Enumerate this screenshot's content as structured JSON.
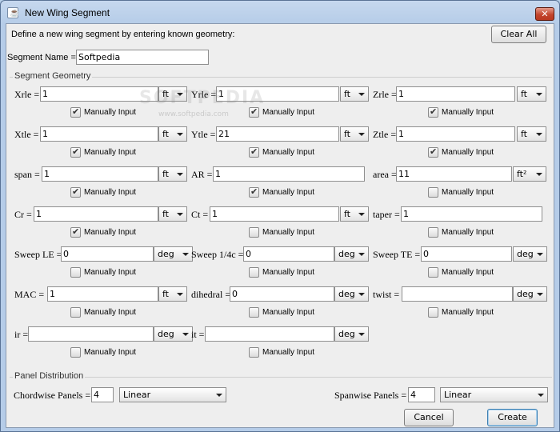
{
  "window": {
    "title": "New Wing Segment",
    "close_glyph": "✕"
  },
  "header": {
    "instruction": "Define a new wing segment by entering known geometry:",
    "clear_all_label": "Clear All"
  },
  "segment_name": {
    "label": "Segment Name =",
    "value": "Softpedia"
  },
  "geometry": {
    "title": "Segment Geometry",
    "checkbox_label": "Manually Input",
    "rows": [
      [
        {
          "label": "Xrle =",
          "value": "1",
          "unit": "ft",
          "checked": true
        },
        {
          "label": "Yrle =",
          "value": "1",
          "unit": "ft",
          "checked": true
        },
        {
          "label": "Zrle =",
          "value": "1",
          "unit": "ft",
          "checked": true
        }
      ],
      [
        {
          "label": "Xtle =",
          "value": "1",
          "unit": "ft",
          "checked": true
        },
        {
          "label": "Ytle =",
          "value": "21",
          "unit": "ft",
          "checked": true
        },
        {
          "label": "Ztle =",
          "value": "1",
          "unit": "ft",
          "checked": true
        }
      ],
      [
        {
          "label": "span =",
          "value": "1",
          "unit": "ft",
          "checked": true
        },
        {
          "label": "AR =",
          "value": "1",
          "unit": "",
          "checked": true
        },
        {
          "label": "area =",
          "value": "11",
          "unit": "ft²",
          "checked": false
        }
      ],
      [
        {
          "label": "Cr =",
          "value": "1",
          "unit": "ft",
          "checked": true
        },
        {
          "label": "Ct =",
          "value": "1",
          "unit": "ft",
          "checked": false
        },
        {
          "label": "taper =",
          "value": "1",
          "unit": "",
          "checked": false
        }
      ],
      [
        {
          "label": "Sweep LE =",
          "value": "0",
          "unit": "deg",
          "checked": false
        },
        {
          "label": "Sweep 1/4c =",
          "value": "0",
          "unit": "deg",
          "checked": false
        },
        {
          "label": "Sweep TE =",
          "value": "0",
          "unit": "deg",
          "checked": false
        }
      ],
      [
        {
          "label": "MAC =",
          "value": "1",
          "unit": "ft",
          "checked": false
        },
        {
          "label": "dihedral =",
          "value": "0",
          "unit": "deg",
          "checked": false
        },
        {
          "label": "twist =",
          "value": "",
          "unit": "deg",
          "checked": false
        }
      ],
      [
        {
          "label": "ir =",
          "value": "",
          "unit": "deg",
          "checked": false
        },
        {
          "label": "it =",
          "value": "",
          "unit": "deg",
          "checked": false
        }
      ]
    ]
  },
  "panels": {
    "title": "Panel Distribution",
    "chordwise": {
      "label": "Chordwise Panels =",
      "value": "4",
      "distribution": "Linear"
    },
    "spanwise": {
      "label": "Spanwise Panels =",
      "value": "4",
      "distribution": "Linear"
    }
  },
  "footer": {
    "cancel_label": "Cancel",
    "create_label": "Create"
  },
  "watermark": {
    "text": "SOFTPEDIA",
    "url": "www.softpedia.com"
  }
}
